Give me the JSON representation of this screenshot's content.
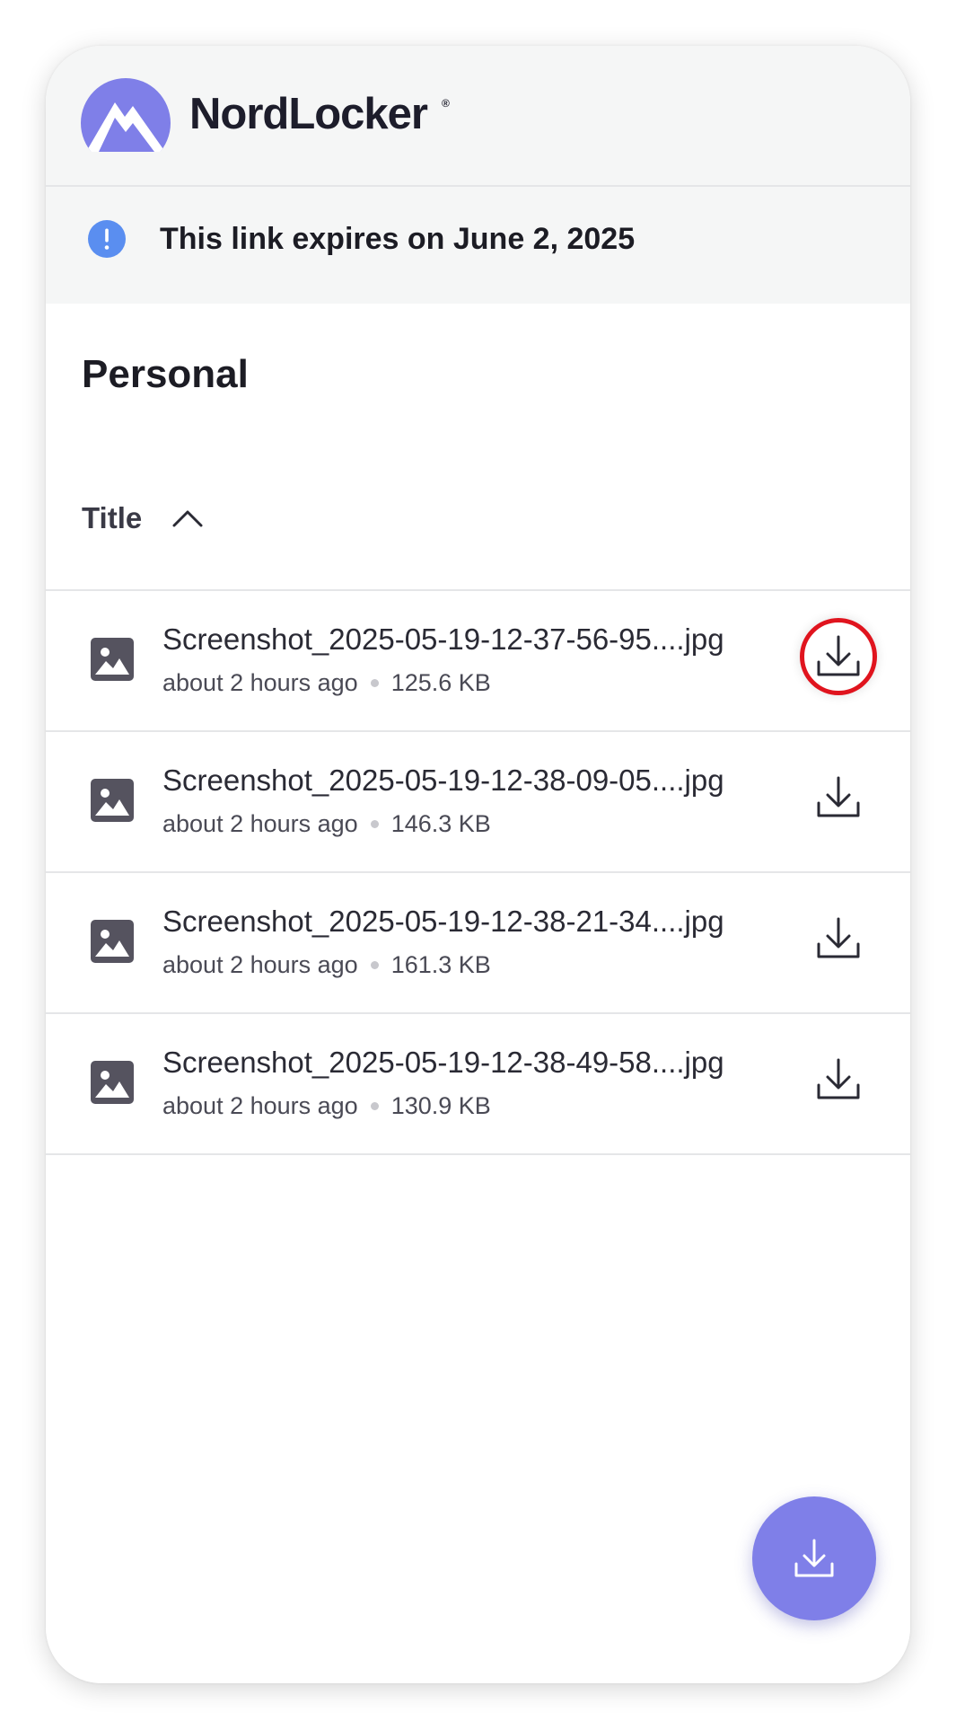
{
  "app": {
    "brand_name": "NordLocker",
    "registered_mark": "®",
    "logo_icon": "nordlocker-mountain-logo",
    "brand_color": "#7f7fe8"
  },
  "notice": {
    "icon": "info-exclamation-icon",
    "icon_color": "#5a8ef0",
    "text": "This link expires on June 2, 2025"
  },
  "folder": {
    "title": "Personal"
  },
  "sort": {
    "label": "Title",
    "direction": "ascending",
    "icon": "chevron-up-icon"
  },
  "files": [
    {
      "name": "Screenshot_2025-05-19-12-37-56-95....jpg",
      "modified": "about 2 hours ago",
      "size": "125.6 KB",
      "icon": "image-file-icon",
      "highlighted": true
    },
    {
      "name": "Screenshot_2025-05-19-12-38-09-05....jpg",
      "modified": "about 2 hours ago",
      "size": "146.3 KB",
      "icon": "image-file-icon",
      "highlighted": false
    },
    {
      "name": "Screenshot_2025-05-19-12-38-21-34....jpg",
      "modified": "about 2 hours ago",
      "size": "161.3 KB",
      "icon": "image-file-icon",
      "highlighted": false
    },
    {
      "name": "Screenshot_2025-05-19-12-38-49-58....jpg",
      "modified": "about 2 hours ago",
      "size": "130.9 KB",
      "icon": "image-file-icon",
      "highlighted": false
    }
  ],
  "fab": {
    "icon": "download-icon"
  },
  "colors": {
    "highlight_ring": "#e0141e",
    "header_bg": "#f5f6f6",
    "divider": "#e5e6e8"
  }
}
